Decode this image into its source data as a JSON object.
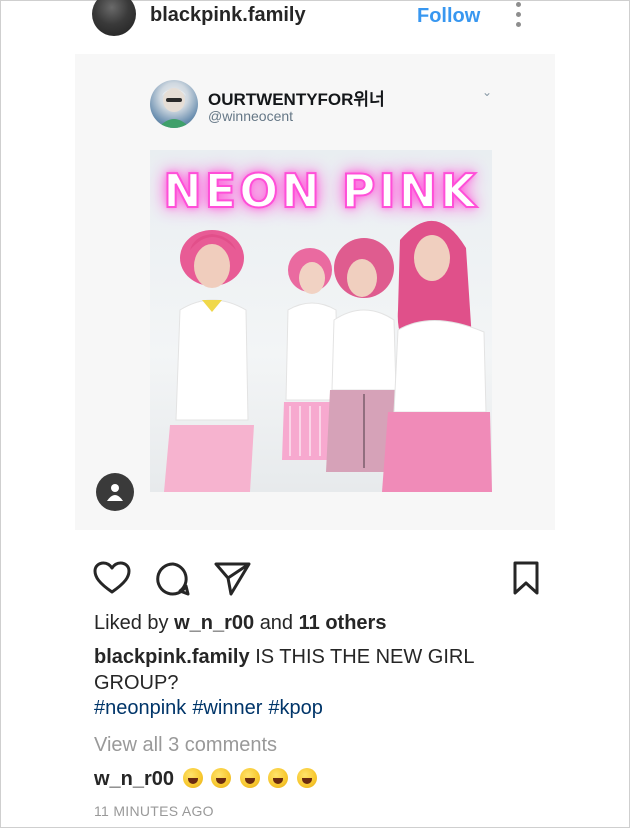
{
  "header": {
    "username": "blackpink.family",
    "follow_label": "Follow",
    "more_icon": "more-vertical-icon"
  },
  "tweet": {
    "display_name": "OURTWENTYFOR위너",
    "handle": "@winneocent",
    "caret_icon": "chevron-down-icon",
    "poster_title": "NEON PINK"
  },
  "actions": {
    "like_icon": "heart-icon",
    "comment_icon": "comment-icon",
    "share_icon": "send-icon",
    "save_icon": "bookmark-icon"
  },
  "likes": {
    "prefix": "Liked by",
    "user": "w_n_r00",
    "joiner": "and",
    "others": "11 others"
  },
  "caption": {
    "username": "blackpink.family",
    "text": "IS THIS THE NEW GIRL GROUP?",
    "hashtags": [
      "#neonpink",
      "#winner",
      "#kpop"
    ]
  },
  "comments": {
    "view_all": "View all 3 comments",
    "latest_user": "w_n_r00",
    "emoji_count": 5
  },
  "timestamp": "11 MINUTES AGO",
  "colors": {
    "link_blue": "#3897f0",
    "hashtag": "#003569",
    "neon_pink": "#ff4fd8"
  }
}
